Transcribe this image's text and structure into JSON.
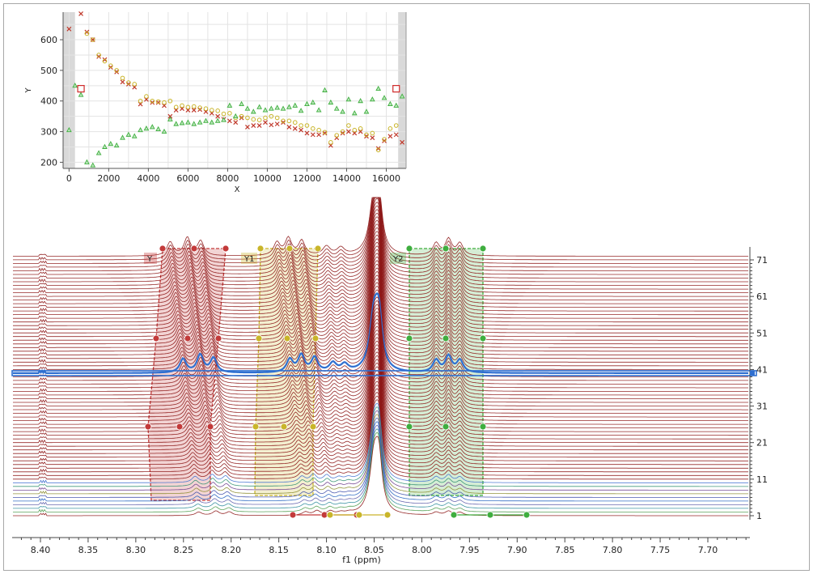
{
  "colors": {
    "spectrum": "#8b1212",
    "region_Y": "#c33a3a",
    "region_Y1": "#c9b52a",
    "region_Y2": "#3fae3f",
    "highlight_row": "#2f6fd0",
    "frame": "#a8a8a8"
  },
  "chart_data": [
    {
      "type": "scatter",
      "name": "inset",
      "xlabel": "X",
      "ylabel": "Y",
      "xlim": [
        -300,
        17000
      ],
      "ylim": [
        180,
        690
      ],
      "x_ticks": [
        "0",
        "2000",
        "4000",
        "6000",
        "8000",
        "10000",
        "12000",
        "14000",
        "16000"
      ],
      "y_ticks": [
        "200",
        "300",
        "400",
        "500",
        "600"
      ],
      "grid": true,
      "shaded_x_ranges": [
        [
          -300,
          300
        ],
        [
          16600,
          17000
        ]
      ],
      "markers": [
        [
          600,
          440
        ],
        [
          16500,
          440
        ]
      ],
      "series": [
        {
          "marker": "cross",
          "color": "#c0392b",
          "x": [
            0,
            600,
            900,
            1200,
            1500,
            1800,
            2100,
            2400,
            2700,
            3000,
            3300,
            3600,
            3900,
            4200,
            4500,
            4800,
            5100,
            5400,
            5700,
            6000,
            6300,
            6600,
            6900,
            7200,
            7500,
            7800,
            8100,
            8400,
            8700,
            9000,
            9300,
            9600,
            9900,
            10200,
            10500,
            10800,
            11100,
            11400,
            11700,
            12000,
            12300,
            12600,
            12900,
            13200,
            13500,
            13800,
            14100,
            14400,
            14700,
            15000,
            15300,
            15600,
            15900,
            16200,
            16500,
            16800
          ],
          "y": [
            635,
            685,
            625,
            600,
            545,
            535,
            510,
            495,
            462,
            455,
            445,
            390,
            405,
            395,
            395,
            385,
            350,
            370,
            375,
            370,
            370,
            372,
            365,
            360,
            350,
            340,
            335,
            330,
            345,
            315,
            320,
            320,
            330,
            322,
            325,
            330,
            315,
            310,
            305,
            295,
            290,
            290,
            295,
            255,
            280,
            295,
            300,
            295,
            300,
            285,
            280,
            245,
            270,
            285,
            290,
            265
          ]
        },
        {
          "marker": "circle",
          "color": "#c9b52a",
          "x": [
            900,
            1200,
            1500,
            1800,
            2100,
            2400,
            2700,
            3000,
            3300,
            3600,
            3900,
            4200,
            4500,
            4800,
            5100,
            5400,
            5700,
            6000,
            6300,
            6600,
            6900,
            7200,
            7500,
            7800,
            8100,
            8400,
            8700,
            9000,
            9300,
            9600,
            9900,
            10200,
            10500,
            10800,
            11100,
            11400,
            11700,
            12000,
            12300,
            12600,
            12900,
            13200,
            13500,
            13800,
            14100,
            14400,
            14700,
            15000,
            15300,
            15600,
            15900,
            16200,
            16500
          ],
          "y": [
            620,
            600,
            550,
            530,
            515,
            500,
            475,
            460,
            455,
            400,
            415,
            400,
            398,
            395,
            400,
            380,
            385,
            380,
            382,
            378,
            375,
            370,
            368,
            358,
            360,
            345,
            350,
            345,
            340,
            338,
            345,
            350,
            345,
            335,
            335,
            330,
            320,
            320,
            310,
            305,
            298,
            265,
            288,
            300,
            320,
            305,
            310,
            290,
            295,
            240,
            275,
            310,
            320
          ]
        },
        {
          "marker": "triangle",
          "color": "#3fae3f",
          "x": [
            0,
            300,
            600,
            900,
            1200,
            1500,
            1800,
            2100,
            2400,
            2700,
            3000,
            3300,
            3600,
            3900,
            4200,
            4500,
            4800,
            5100,
            5400,
            5700,
            6000,
            6300,
            6600,
            6900,
            7200,
            7500,
            7800,
            8100,
            8400,
            8700,
            9000,
            9300,
            9600,
            9900,
            10200,
            10500,
            10800,
            11100,
            11400,
            11700,
            12000,
            12300,
            12600,
            12900,
            13200,
            13500,
            13800,
            14100,
            14400,
            14700,
            15000,
            15300,
            15600,
            15900,
            16200,
            16500,
            16800
          ],
          "y": [
            305,
            450,
            420,
            200,
            190,
            230,
            250,
            260,
            255,
            280,
            290,
            285,
            305,
            310,
            315,
            308,
            300,
            340,
            325,
            328,
            330,
            325,
            330,
            335,
            330,
            335,
            338,
            385,
            350,
            390,
            375,
            365,
            380,
            370,
            375,
            378,
            375,
            380,
            385,
            368,
            390,
            395,
            370,
            435,
            395,
            375,
            365,
            405,
            360,
            400,
            365,
            405,
            440,
            410,
            390,
            385,
            415
          ]
        }
      ]
    },
    {
      "type": "line",
      "name": "stacked-spectra",
      "xlabel": "f1 (ppm)",
      "x_ticks": [
        "8.40",
        "8.35",
        "8.30",
        "8.25",
        "8.20",
        "8.15",
        "8.10",
        "8.05",
        "8.00",
        "7.95",
        "7.90",
        "7.85",
        "7.80",
        "7.75",
        "7.70"
      ],
      "xlim": [
        8.43,
        7.65
      ],
      "y_ticks": [
        "71",
        "61",
        "51",
        "41",
        "31",
        "21",
        "11",
        "1"
      ],
      "ylim": [
        1,
        72
      ],
      "rows": 72,
      "highlighted_row": 40,
      "regions": [
        {
          "label": "Y",
          "color_key": "region_Y"
        },
        {
          "label": "Y1",
          "color_key": "region_Y1"
        },
        {
          "label": "Y2",
          "color_key": "region_Y2"
        }
      ]
    }
  ]
}
